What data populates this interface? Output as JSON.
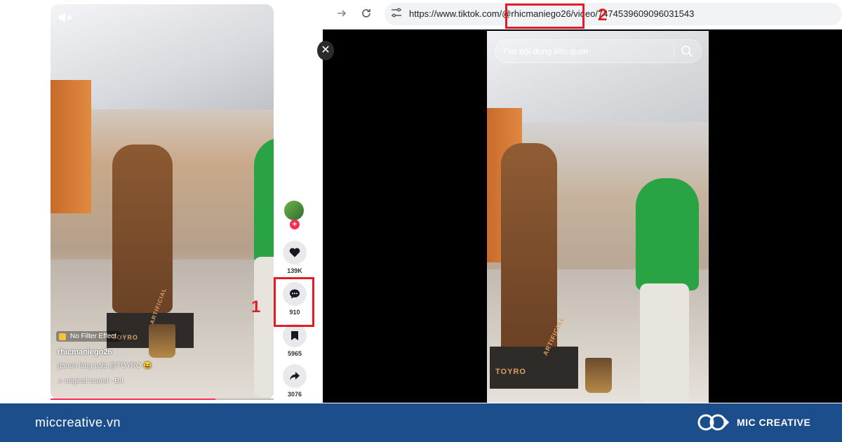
{
  "phone_panel": {
    "effect_label": "No Filter Effect",
    "username": "rhicmaniego26",
    "caption": "ganun lang pala @TOYRO",
    "caption_emoji": "😆",
    "sound_prefix": "♫",
    "sound": "original sound - Bri",
    "pedestal_brand": "TOYRO",
    "pedestal_text": "ARTIFICIAL",
    "progress_fraction": 0.74,
    "actions": {
      "likes": "139K",
      "comments": "910",
      "saves": "5965",
      "shares": "3076"
    }
  },
  "browser": {
    "url": "https://www.tiktok.com/@rhicmaniego26/video/7474539609096031543",
    "search_placeholder": "Tìm nội dung liên quan",
    "video_pedestal_brand": "TOYRO",
    "video_pedestal_text": "ARTIFICIAL"
  },
  "annotations": {
    "step1": "1",
    "step2": "2",
    "highlight_color": "#e21d25"
  },
  "footer": {
    "site": "miccreative.vn",
    "brand": "MIC CREATIVE",
    "background": "#1d4e8c"
  },
  "colors": {
    "tiktok_red": "#fe2c55",
    "jacket_green": "#2aa344"
  }
}
